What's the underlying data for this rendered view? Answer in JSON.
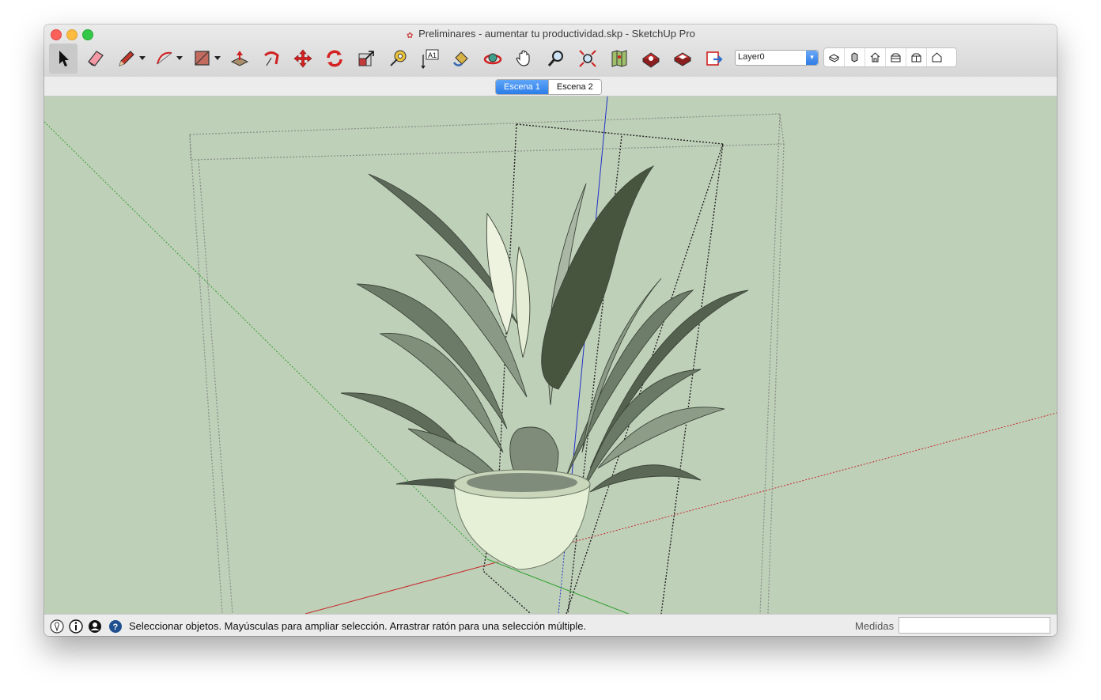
{
  "window": {
    "title": "Preliminares -  aumentar tu productividad.skp - SketchUp Pro"
  },
  "toolbar": {
    "tools": [
      {
        "name": "select-tool",
        "icon": "arrow-cursor-icon",
        "active": true
      },
      {
        "name": "eraser-tool",
        "icon": "eraser-icon"
      },
      {
        "name": "pencil-tool",
        "icon": "pencil-icon",
        "has_dropdown": true
      },
      {
        "name": "arc-tool",
        "icon": "arc-icon",
        "has_dropdown": true
      },
      {
        "name": "rectangle-tool",
        "icon": "rectangle-icon",
        "has_dropdown": true
      },
      {
        "name": "push-pull-tool",
        "icon": "push-pull-icon"
      },
      {
        "name": "follow-me-tool",
        "icon": "follow-me-icon"
      },
      {
        "name": "move-tool",
        "icon": "move-icon"
      },
      {
        "name": "rotate-tool",
        "icon": "rotate-icon"
      },
      {
        "name": "scale-tool",
        "icon": "scale-icon"
      },
      {
        "name": "tape-measure-tool",
        "icon": "tape-measure-icon"
      },
      {
        "name": "text-tool",
        "icon": "text-a1-icon",
        "label": "A1"
      },
      {
        "name": "paint-bucket-tool",
        "icon": "paint-bucket-icon"
      },
      {
        "name": "orbit-tool",
        "icon": "orbit-icon"
      },
      {
        "name": "pan-tool",
        "icon": "hand-icon"
      },
      {
        "name": "zoom-tool",
        "icon": "magnifier-icon"
      },
      {
        "name": "zoom-extents-tool",
        "icon": "zoom-extents-icon"
      },
      {
        "name": "add-location-tool",
        "icon": "map-icon"
      },
      {
        "name": "3d-warehouse-tool",
        "icon": "warehouse-icon"
      },
      {
        "name": "extension-warehouse-tool",
        "icon": "extension-icon"
      },
      {
        "name": "layout-send-tool",
        "icon": "layout-icon"
      }
    ],
    "layer_select": {
      "value": "Layer0"
    },
    "views": [
      {
        "name": "iso-view",
        "icon": "iso-view-icon"
      },
      {
        "name": "top-view",
        "icon": "top-view-icon"
      },
      {
        "name": "front-view",
        "icon": "front-view-icon"
      },
      {
        "name": "right-view",
        "icon": "right-view-icon"
      },
      {
        "name": "back-view",
        "icon": "back-view-icon"
      },
      {
        "name": "left-view",
        "icon": "left-view-icon"
      }
    ]
  },
  "scenes": {
    "tabs": [
      {
        "label": "Escena 1",
        "selected": true
      },
      {
        "label": "Escena 2",
        "selected": false
      }
    ]
  },
  "viewport": {
    "background": "#bfd0b9",
    "axis_colors": {
      "red": "#c42a2a",
      "green": "#2ea02e",
      "blue": "#2030c8"
    }
  },
  "statusbar": {
    "message": "Seleccionar objetos. Mayúsculas para ampliar selección. Arrastrar ratón para una selección múltiple.",
    "measure_label": "Medidas",
    "measure_value": ""
  }
}
